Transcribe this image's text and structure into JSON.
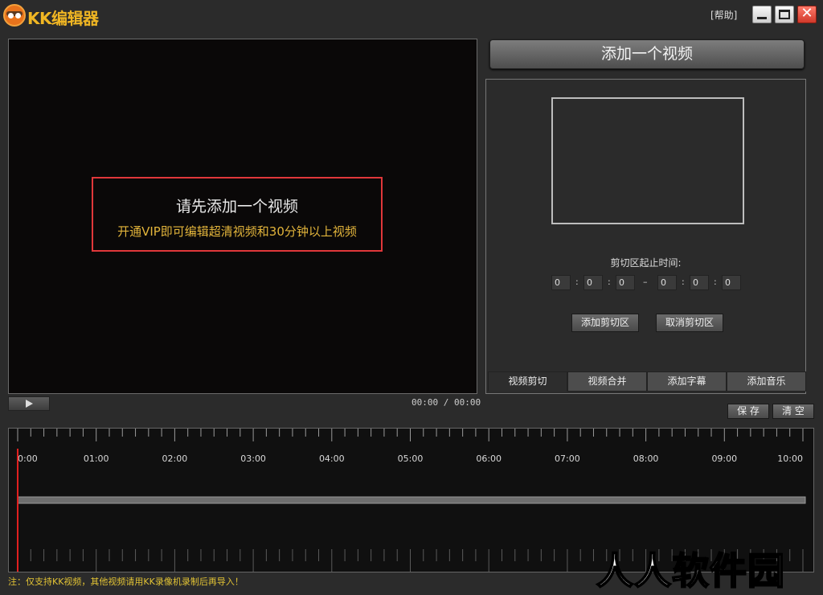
{
  "app": {
    "title": "KK编辑器",
    "help": "[帮助]"
  },
  "preview": {
    "notice_line1": "请先添加一个视频",
    "notice_line2": "开通VIP即可编辑超清视频和30分钟以上视频",
    "time": "00:00 / 00:00"
  },
  "side": {
    "add_video": "添加一个视频",
    "cut_range_label": "剪切区起止时间:",
    "start": [
      "0",
      "0",
      "0"
    ],
    "end": [
      "0",
      "0",
      "0"
    ],
    "colon": ":",
    "dash": "–",
    "add_cut": "添加剪切区",
    "cancel_cut": "取消剪切区",
    "tabs": [
      "视频剪切",
      "视频合并",
      "添加字幕",
      "添加音乐"
    ]
  },
  "actions": {
    "save": "保 存",
    "clear": "清 空"
  },
  "timeline": {
    "labels": [
      "0:00",
      "01:00",
      "02:00",
      "03:00",
      "04:00",
      "05:00",
      "06:00",
      "07:00",
      "08:00",
      "09:00",
      "10:00"
    ],
    "playhead_color": "#e02020"
  },
  "footer": {
    "note": "注：仅支持KK视频，其他视频请用KK录像机录制后再导入！"
  },
  "watermark": "人人软件园"
}
